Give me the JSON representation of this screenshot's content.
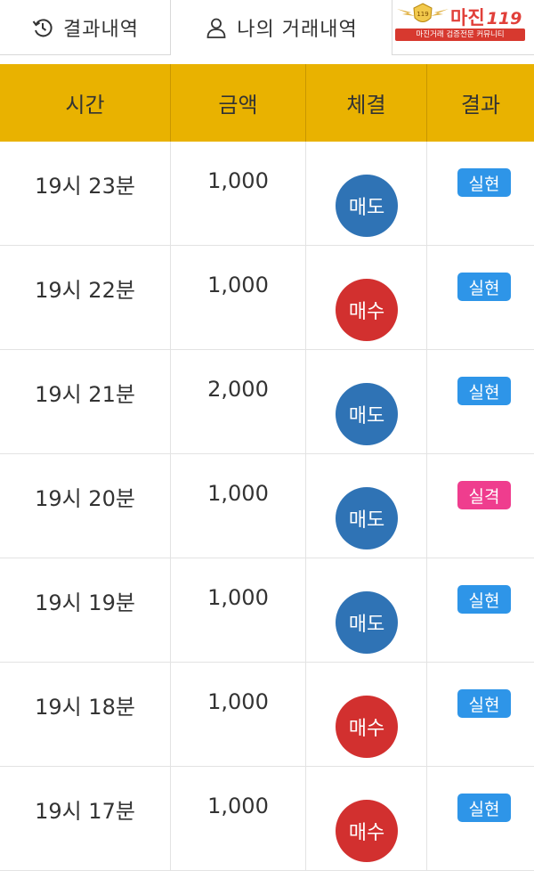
{
  "tabs": {
    "history_label": "결과내역",
    "my_trades_label": "나의 거래내역"
  },
  "logo": {
    "title": "마진",
    "number": "119",
    "tagline": "마진거래 검증전문 커뮤니티"
  },
  "table": {
    "headers": [
      "시간",
      "금액",
      "체결",
      "결과"
    ],
    "rows": [
      {
        "time": "19시 23분",
        "amount": "1,000",
        "trade": "매도",
        "result": "실현"
      },
      {
        "time": "19시 22분",
        "amount": "1,000",
        "trade": "매수",
        "result": "실현"
      },
      {
        "time": "19시 21분",
        "amount": "2,000",
        "trade": "매도",
        "result": "실현"
      },
      {
        "time": "19시 20분",
        "amount": "1,000",
        "trade": "매도",
        "result": "실격"
      },
      {
        "time": "19시 19분",
        "amount": "1,000",
        "trade": "매도",
        "result": "실현"
      },
      {
        "time": "19시 18분",
        "amount": "1,000",
        "trade": "매수",
        "result": "실현"
      },
      {
        "time": "19시 17분",
        "amount": "1,000",
        "trade": "매수",
        "result": "실현"
      }
    ]
  },
  "colors": {
    "header_bg": "#e9b200",
    "sell": "#2f73b5",
    "buy": "#d2302f",
    "realized": "#2e95e8",
    "disqualified": "#ef3d8e"
  }
}
